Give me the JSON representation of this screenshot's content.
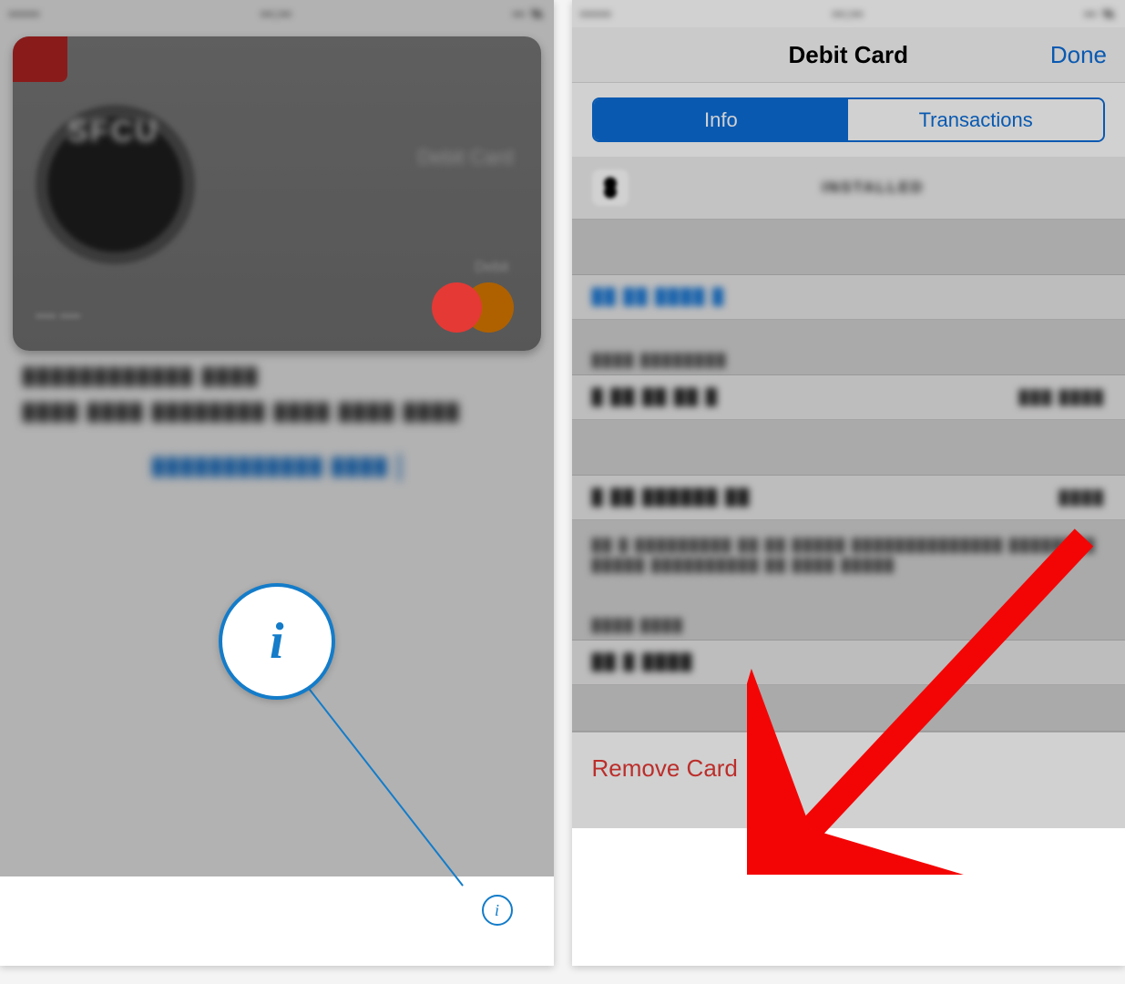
{
  "left": {
    "status": {
      "carrier": "•••••",
      "time": "••:••",
      "battery": "•• %"
    },
    "card": {
      "issuer": "SFCU",
      "type": "Debit Card",
      "network_label": "Debit",
      "last4": "•••• ••••"
    },
    "line1": "████████████ ████",
    "line2": "████ ████ ████████ ████ ████ ████",
    "link": "████████████ ████",
    "info_glyph": "i"
  },
  "right": {
    "status": {
      "carrier": "•••••",
      "time": "••:••",
      "battery": "•• %"
    },
    "nav_title": "Debit Card",
    "nav_done": "Done",
    "segments": {
      "info": "Info",
      "transactions": "Transactions"
    },
    "app_row_label": "INSTALLED",
    "section1_header": "",
    "contact_link": "██ ██ ████ █",
    "section2_header": "████ ████████",
    "row_card_number_label": "█ ██ ██ ██ █",
    "row_card_number_value": "███ ████",
    "section3_header": "",
    "row_device_label": "█ ██ ██████ ██",
    "row_device_value": "████",
    "footnote": "██ █ █████████ ██ ██ █████ ██████████████ ████████ █████ ██████████ ██ ████ █████",
    "section4_header": "████ ████",
    "row_terms_label": "██ █ ████",
    "remove_label": "Remove Card"
  },
  "colors": {
    "accent": "#0b6dd8",
    "danger": "#e53935"
  }
}
